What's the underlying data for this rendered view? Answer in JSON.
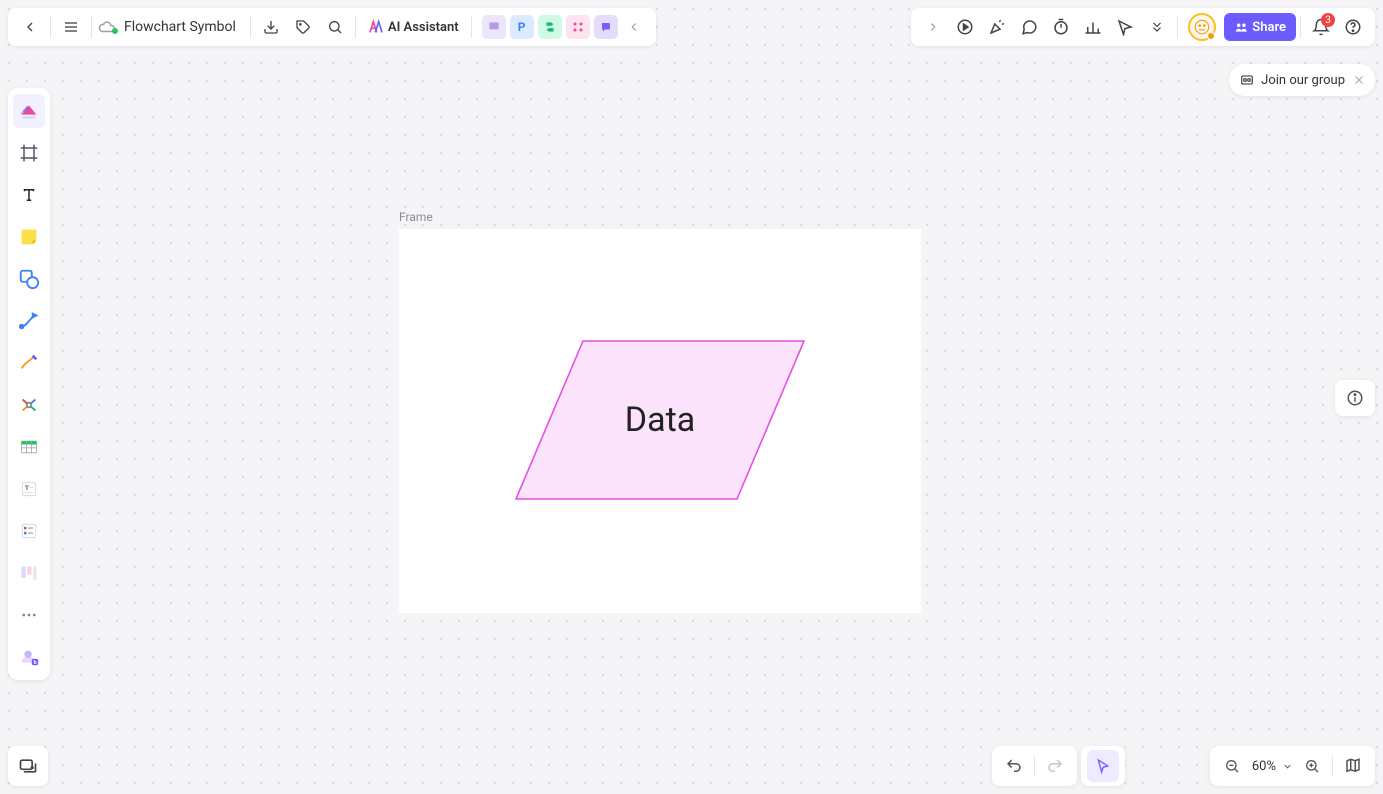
{
  "header": {
    "doc_title": "Flowchart Symbol",
    "ai_label": "AI Assistant",
    "share_label": "Share",
    "notif_count": "3"
  },
  "canvas": {
    "frame_label": "Frame",
    "shape_text": "Data"
  },
  "right": {
    "join_label": "Join our group"
  },
  "footer": {
    "zoom": "60%"
  },
  "colors": {
    "accent": "#6a5cff",
    "shape_stroke": "#e64fe6",
    "shape_fill": "#fbe3fb"
  }
}
